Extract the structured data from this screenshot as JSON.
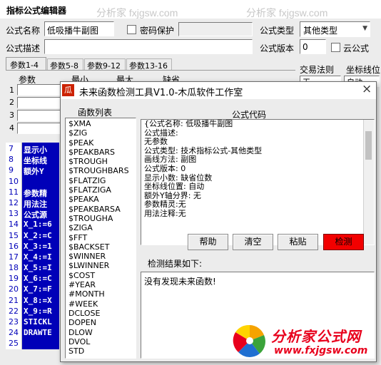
{
  "editor": {
    "title": "指标公式编辑器",
    "name_label": "公式名称",
    "name_value": "低吸播牛副图",
    "password_label": "密码保护",
    "type_label": "公式类型",
    "type_value": "其他类型",
    "desc_label": "公式描述",
    "version_label": "公式版本",
    "version_value": "0",
    "cloud_label": "云公式",
    "tabs": [
      "参数1-4",
      "参数5-8",
      "参数9-12",
      "参数13-16"
    ],
    "param_headers": [
      "参数",
      "最小",
      "最大",
      "缺省"
    ],
    "param_rows": [
      "1",
      "2",
      "3",
      "4"
    ],
    "trade_label": "交易法则",
    "axis_label": "坐标线位",
    "trade_value": "无",
    "axis_value": "自动",
    "code_line_numbers": [
      "7",
      "8",
      "9",
      "10",
      "11",
      "12",
      "13",
      "14",
      "15",
      "16",
      "17",
      "18",
      "19",
      "20",
      "21",
      "22",
      "23",
      "24",
      "25"
    ],
    "code_lines": [
      "显示小",
      "坐标线",
      "额外Y",
      "",
      "参数精",
      "用法注",
      "公式源",
      "X_1:=6",
      "X_2:=C",
      "X_3:=1",
      "X_4:=I",
      "X_5:=I",
      "X_6:=C",
      "X_7:=F",
      "X_8:=X",
      "X_9:=R",
      "STICKL",
      "DRAWTE",
      ""
    ]
  },
  "dialog": {
    "title": "未来函数检测工具V1.0-木瓜软件工作室",
    "logo_text": "瓜",
    "close_label": "×",
    "func_list_header": "函数列表",
    "functions": [
      "$XMA",
      "$ZIG",
      "$PEAK",
      "$PEAKBARS",
      "$TROUGH",
      "$TROUGHBARS",
      "$FLATZIG",
      "$FLATZIGA",
      "$PEAKA",
      "$PEAKBARSA",
      "$TROUGHA",
      "$ZIGA",
      "$FFT",
      "$BACKSET",
      "$WINNER",
      "$LWINNER",
      "$COST",
      "#YEAR",
      "#MONTH",
      "#WEEK",
      "DCLOSE",
      "DOPEN",
      "DLOW",
      "DVOL",
      "STD"
    ],
    "code_header": "公式代码",
    "code_lines": [
      "{公式名称: 低吸播牛副图",
      "公式描述:",
      "无参数",
      "公式类型: 技术指标公式-其他类型",
      "画线方法: 副图",
      "公式版本: 0",
      "显示小数: 缺省位数",
      "坐标线位置: 自动",
      "额外Y轴分界: 无",
      "参数精灵:无",
      "用法注释:无"
    ],
    "buttons": {
      "help": "帮助",
      "clear": "清空",
      "paste": "粘贴",
      "check": "检测"
    },
    "result_label": "检测结果如下:",
    "result_text": "没有发现未来函数!"
  },
  "watermark": {
    "text": "分析家 fxjgsw.com",
    "logo_text": "分析家公式网",
    "logo_url": "www.fxjgsw.com"
  },
  "colors": {
    "code_bg": "#0000b8",
    "check_button": "#f20000",
    "logo_red": "#e8001c"
  }
}
